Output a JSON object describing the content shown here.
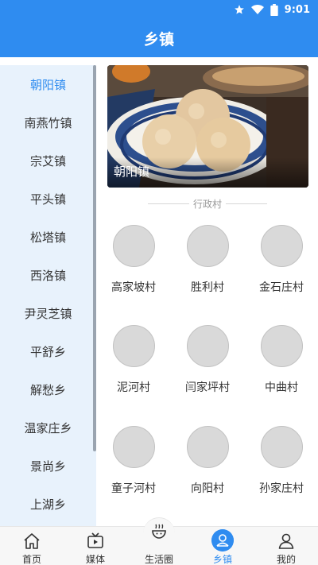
{
  "status": {
    "time": "9:01"
  },
  "header": {
    "title": "乡镇"
  },
  "sidebar": {
    "items": [
      {
        "label": "朝阳镇",
        "active": true
      },
      {
        "label": "南燕竹镇"
      },
      {
        "label": "宗艾镇"
      },
      {
        "label": "平头镇"
      },
      {
        "label": "松塔镇"
      },
      {
        "label": "西洛镇"
      },
      {
        "label": "尹灵芝镇"
      },
      {
        "label": "平舒乡"
      },
      {
        "label": "解愁乡"
      },
      {
        "label": "温家庄乡"
      },
      {
        "label": "景尚乡"
      },
      {
        "label": "上湖乡"
      }
    ]
  },
  "banner": {
    "title": "朝阳镇"
  },
  "section": {
    "label": "行政村"
  },
  "villages": [
    {
      "name": "高家坡村"
    },
    {
      "name": "胜利村"
    },
    {
      "name": "金石庄村"
    },
    {
      "name": "泥河村"
    },
    {
      "name": "闫家坪村"
    },
    {
      "name": "中曲村"
    },
    {
      "name": "童子河村"
    },
    {
      "name": "向阳村"
    },
    {
      "name": "孙家庄村"
    }
  ],
  "nav": {
    "items": [
      {
        "label": "首页",
        "icon": "home-icon"
      },
      {
        "label": "媒体",
        "icon": "tv-icon"
      },
      {
        "label": "生活圈",
        "icon": "life-circle-icon"
      },
      {
        "label": "乡镇",
        "icon": "town-icon",
        "active": true
      },
      {
        "label": "我的",
        "icon": "user-icon"
      }
    ]
  },
  "colors": {
    "primary": "#2f8cf0",
    "sidebar_bg": "#e8f2fc",
    "placeholder": "#d9d9d9"
  }
}
